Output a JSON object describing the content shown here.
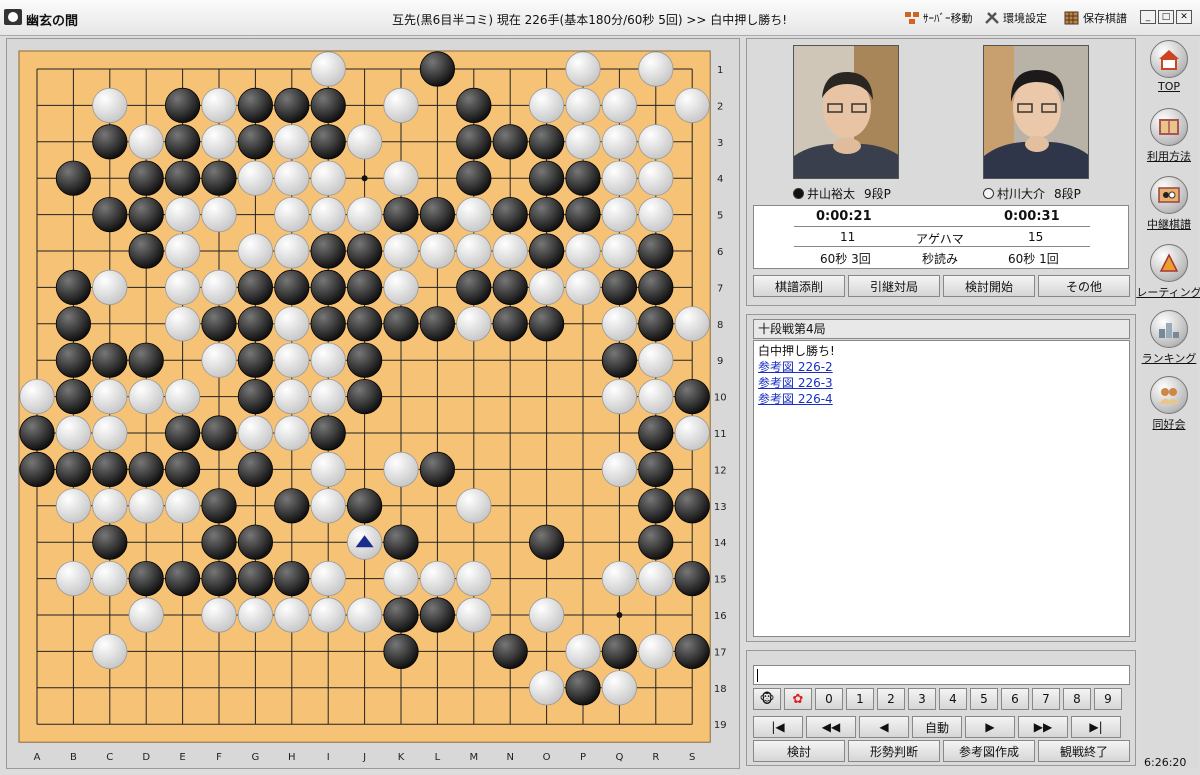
{
  "app": {
    "name": "幽玄の間"
  },
  "header": {
    "game_info": "互先(黒6目半コミ) 現在 226手(基本180分/60秒 5回) >> 白中押し勝ち!",
    "server_move": "ｻｰﾊﾞｰ移動",
    "settings": "環境設定",
    "saved_kifu": "保存棋譜"
  },
  "board": {
    "size": 19,
    "col_labels": [
      "A",
      "B",
      "C",
      "D",
      "E",
      "F",
      "G",
      "H",
      "I",
      "J",
      "K",
      "L",
      "M",
      "N",
      "O",
      "P",
      "Q",
      "R",
      "S"
    ],
    "row_labels": [
      "1",
      "2",
      "3",
      "4",
      "5",
      "6",
      "7",
      "8",
      "9",
      "10",
      "11",
      "12",
      "13",
      "14",
      "15",
      "16",
      "17",
      "18",
      "19"
    ],
    "rows": [
      "........W..B...W.W.",
      "..W.BWBBB.W.B.WWW.W",
      "..BWBWBWBW..BBBWWW.",
      ".B.BBBWWW.W.B.BBWW.W",
      "..BBWW.WWWBBWBBBWW.",
      "...BW.WWBBWWWWBWWB.",
      ".BW.WWBBBBW.BBWWBB.",
      ".B..WBBWBBBBWBB.WBW",
      ".BBB.WBWWB......BW.",
      "WBWWW.BWWB......WWB",
      "BWW.BBWWB........BW",
      "BBBBB.B.W.WB....WB.",
      ".WWWWB.BWB..W....BB",
      "..B..BB...B...B..B.",
      ".WWBBBBBW.WWW...WWB",
      "...W.WWWWWBBW.W....",
      "..W.......B..B.WBWB",
      "..............WBW..",
      "..................."
    ],
    "last_move": "J14",
    "hoshi": [
      "D4",
      "J4",
      "Q4",
      "D10",
      "J10",
      "Q10",
      "D16",
      "J16",
      "Q16"
    ]
  },
  "players": {
    "black": {
      "name": "井山裕太",
      "rank": "9段P"
    },
    "white": {
      "name": "村川大介",
      "rank": "8段P"
    }
  },
  "clock": {
    "black_time": "0:00:21",
    "white_time": "0:00:31",
    "captures_label": "アゲハマ",
    "black_captures": "11",
    "white_captures": "15",
    "byoyomi_label": "秒読み",
    "black_byoyomi": "60秒 3回",
    "white_byoyomi": "60秒 1回"
  },
  "action_buttons": [
    "棋譜添削",
    "引継対局",
    "検討開始",
    "その他"
  ],
  "comments": {
    "title": "十段戦第4局",
    "result": "白中押し勝ち!",
    "links": [
      "参考図 226-2",
      "参考図 226-3",
      "参考図 226-4"
    ]
  },
  "chat": {
    "emoji_buttons": [
      "monkey-emoji",
      "flower-emoji"
    ],
    "number_buttons": [
      "0",
      "1",
      "2",
      "3",
      "4",
      "5",
      "6",
      "7",
      "8",
      "9"
    ]
  },
  "navigation": {
    "buttons": [
      "|◀",
      "◀◀",
      "◀",
      "自動",
      "▶",
      "▶▶",
      "▶|"
    ],
    "bottom_buttons": [
      "検討",
      "形勢判断",
      "参考図作成",
      "観戦終了"
    ]
  },
  "sidebar": [
    {
      "label": "TOP",
      "icon": "house-icon"
    },
    {
      "label": "利用方法",
      "icon": "book-icon"
    },
    {
      "label": "中継棋譜",
      "icon": "relay-icon"
    },
    {
      "label": "レーティング",
      "icon": "rating-icon"
    },
    {
      "label": "ランキング",
      "icon": "ranking-icon"
    },
    {
      "label": "同好会",
      "icon": "club-icon"
    }
  ],
  "clock_time": "6:26:20",
  "colors": {
    "board": "#f6c275",
    "black_stone": "#111111",
    "white_stone": "#f4f4f4",
    "link": "#1a2fc4",
    "last_move_marker": "#1a2c8c"
  }
}
